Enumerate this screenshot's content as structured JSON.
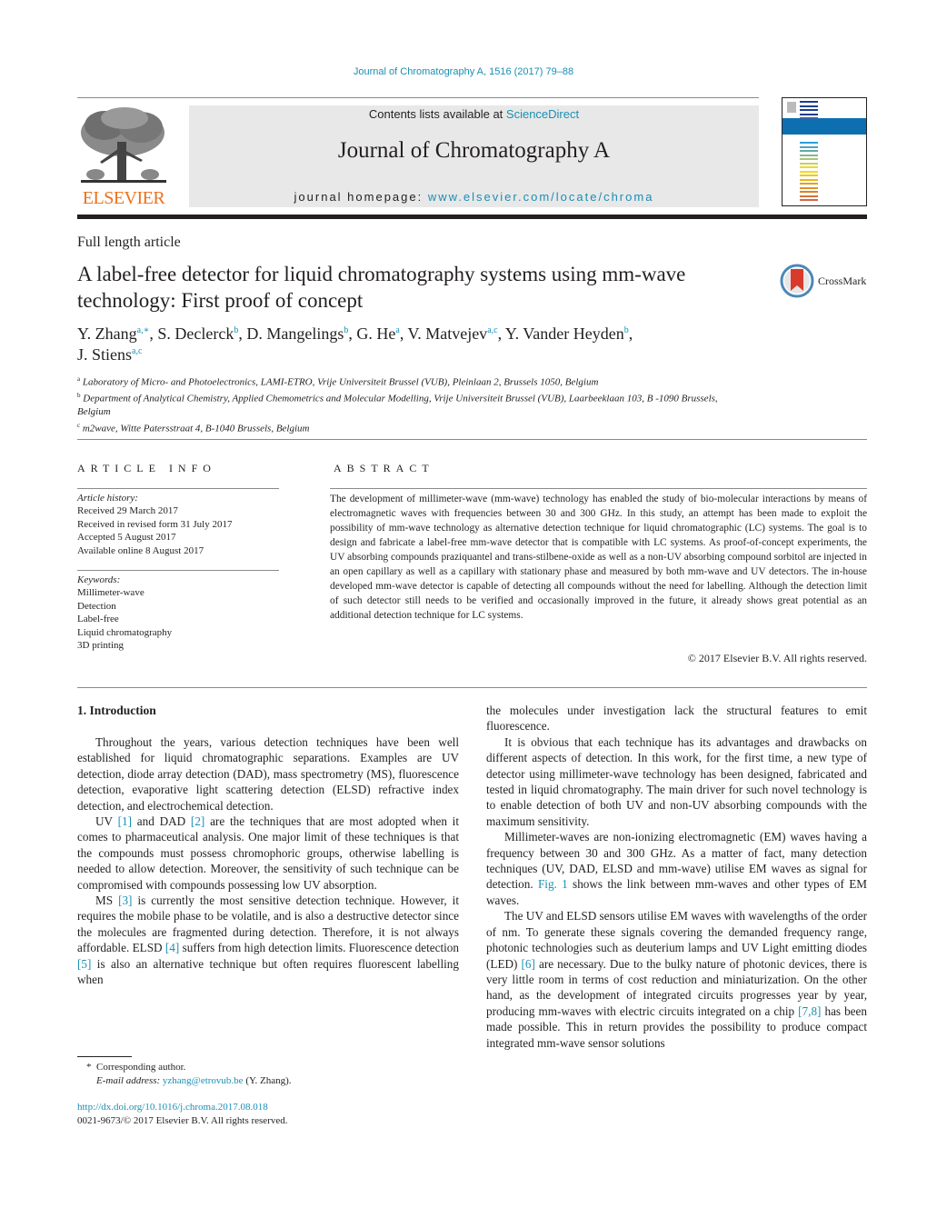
{
  "header": {
    "citation": "Journal of Chromatography A, 1516 (2017) 79–88",
    "contents_prefix": "Contents lists available at ",
    "contents_link": "ScienceDirect",
    "journal_title": "Journal of Chromatography A",
    "homepage_prefix": "journal homepage: ",
    "homepage_link": "www.elsevier.com/locate/chroma",
    "publisher_logo_text": "ELSEVIER",
    "crossmark_label": "CrossMark"
  },
  "article": {
    "type": "Full length article",
    "title": "A label-free detector for liquid chromatography systems using mm-wave technology: First proof of concept",
    "authors": [
      {
        "name": "Y. Zhang",
        "sup": "a,∗",
        "sep": ", "
      },
      {
        "name": "S. Declerck",
        "sup": "b",
        "sep": ", "
      },
      {
        "name": "D. Mangelings",
        "sup": "b",
        "sep": ", "
      },
      {
        "name": "G. He",
        "sup": "a",
        "sep": ", "
      },
      {
        "name": "V. Matvejev",
        "sup": "a,c",
        "sep": ", "
      },
      {
        "name": "Y. Vander Heyden",
        "sup": "b",
        "sep": ","
      },
      {
        "name": "J. Stiens",
        "sup": "a,c",
        "sep": ""
      }
    ],
    "affiliations": [
      {
        "key": "a",
        "text": "Laboratory of Micro- and Photoelectronics, LAMI-ETRO, Vrije Universiteit Brussel (VUB), Pleinlaan 2, Brussels 1050, Belgium"
      },
      {
        "key": "b",
        "text": "Department of Analytical Chemistry, Applied Chemometrics and Molecular Modelling, Vrije Universiteit Brussel (VUB), Laarbeeklaan 103, B -1090 Brussels, Belgium"
      },
      {
        "key": "c",
        "text": "m2wave, Witte Patersstraat 4, B-1040 Brussels, Belgium"
      }
    ]
  },
  "article_info": {
    "heading": "ARTICLE INFO",
    "history_label": "Article history:",
    "history": [
      "Received 29 March 2017",
      "Received in revised form 31 July 2017",
      "Accepted 5 August 2017",
      "Available online 8 August 2017"
    ],
    "keywords_label": "Keywords:",
    "keywords": [
      "Millimeter-wave",
      "Detection",
      "Label-free",
      "Liquid chromatography",
      "3D printing"
    ]
  },
  "abstract": {
    "heading": "ABSTRACT",
    "text": "The development of millimeter-wave (mm-wave) technology has enabled the study of bio-molecular interactions by means of electromagnetic waves with frequencies between 30 and 300 GHz. In this study, an attempt has been made to exploit the possibility of mm-wave technology as alternative detection technique for liquid chromatographic (LC) systems. The goal is to design and fabricate a label-free mm-wave detector that is compatible with LC systems. As proof-of-concept experiments, the UV absorbing compounds praziquantel and trans-stilbene-oxide as well as a non-UV absorbing compound sorbitol are injected in an open capillary as well as a capillary with stationary phase and measured by both mm-wave and UV detectors. The in-house developed mm-wave detector is capable of detecting all compounds without the need for labelling. Although the detection limit of such detector still needs to be verified and occasionally improved in the future, it already shows great potential as an additional detection technique for LC systems.",
    "copyright": "© 2017 Elsevier B.V. All rights reserved."
  },
  "body": {
    "section_heading": "1.  Introduction",
    "left_paragraphs": [
      [
        {
          "t": "Throughout the years, various detection techniques have been well established for liquid chromatographic separations. Examples are UV detection, diode array detection (DAD), mass spectrometry (MS), fluorescence detection, evaporative light scattering detection (ELSD) refractive index detection, and electrochemical detection."
        }
      ],
      [
        {
          "t": "UV "
        },
        {
          "ref": "[1]"
        },
        {
          "t": " and DAD "
        },
        {
          "ref": "[2]"
        },
        {
          "t": " are the techniques that are most adopted when it comes to pharmaceutical analysis. One major limit of these techniques is that the compounds must possess chromophoric groups, otherwise labelling is needed to allow detection. Moreover, the sensitivity of such technique can be compromised with compounds possessing low UV absorption."
        }
      ],
      [
        {
          "t": "MS "
        },
        {
          "ref": "[3]"
        },
        {
          "t": " is currently the most sensitive detection technique. However, it requires the mobile phase to be volatile, and is also a destructive detector since the molecules are fragmented during detection. Therefore, it is not always affordable. ELSD "
        },
        {
          "ref": "[4]"
        },
        {
          "t": " suffers from high detection limits. Fluorescence detection "
        },
        {
          "ref": "[5]"
        },
        {
          "t": " is also an alternative technique but often requires fluorescent labelling when"
        }
      ]
    ],
    "right_paragraphs": [
      [
        {
          "t": "the molecules under investigation lack the structural features to emit fluorescence."
        }
      ],
      [
        {
          "t": "It is obvious that each technique has its advantages and drawbacks on different aspects of detection. In this work, for the first time, a new type of detector using millimeter-wave technology has been designed, fabricated and tested in liquid chromatography. The main driver for such novel technology is to enable detection of both UV and non-UV absorbing compounds with the maximum sensitivity."
        }
      ],
      [
        {
          "t": "Millimeter-waves are non-ionizing electromagnetic (EM) waves having a frequency between 30 and 300 GHz. As a matter of fact, many detection techniques (UV, DAD, ELSD and mm-wave) utilise EM waves as signal for detection. "
        },
        {
          "ref": "Fig. 1"
        },
        {
          "t": " shows the link between mm-waves and other types of EM waves."
        }
      ],
      [
        {
          "t": "The UV and ELSD sensors utilise EM waves with wavelengths of the order of nm. To generate these signals covering the demanded frequency range, photonic technologies such as deuterium lamps and UV Light emitting diodes (LED) "
        },
        {
          "ref": "[6]"
        },
        {
          "t": " are necessary. Due to the bulky nature of photonic devices, there is very little room in terms of cost reduction and miniaturization. On the other hand, as the development of integrated circuits progresses year by year, producing mm-waves with electric circuits integrated on a chip "
        },
        {
          "ref": "[7,8]"
        },
        {
          "t": " has been made possible. This in return provides the possibility to produce compact integrated mm-wave sensor solutions"
        }
      ]
    ]
  },
  "footnotes": {
    "star": "*",
    "corresponding": "Corresponding author.",
    "email_label": "E-mail address: ",
    "email": "yzhang@etrovub.be",
    "email_suffix": " (Y. Zhang).",
    "doi": "http://dx.doi.org/10.1016/j.chroma.2017.08.018",
    "issn_copyright": "0021-9673/© 2017 Elsevier B.V. All rights reserved."
  },
  "colors": {
    "link": "#1a8fb3",
    "elsevier_orange": "#e9711c",
    "masthead_bg": "#e8e8e8",
    "cover_band": "#0d6fb0"
  }
}
